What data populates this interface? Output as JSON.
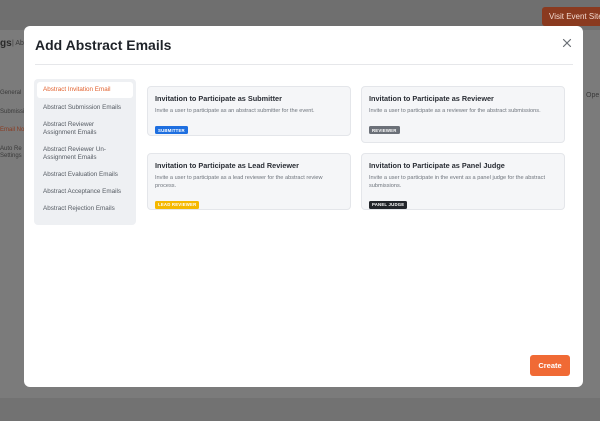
{
  "background": {
    "visit_button": "Visit Event Site",
    "page_title": "gs",
    "page_subtitle": "| Ab",
    "side_items": [
      "General",
      "Submissi",
      "Email No",
      "Auto Re",
      "Settings"
    ],
    "right_label": "Ope"
  },
  "modal": {
    "title": "Add Abstract Emails",
    "close_icon": "close-icon",
    "nav": [
      "Abstract Invitation Email",
      "Abstract Submission Emails",
      "Abstract Reviewer Assignment Emails",
      "Abstract Reviewer Un-Assignment Emails",
      "Abstract Evaluation Emails",
      "Abstract Acceptance Emails",
      "Abstract Rejection Emails"
    ],
    "cards": [
      {
        "title": "Invitation to Participate as Submitter",
        "description": "Invite a user to participate as an abstract submitter for the event.",
        "badge": "SUBMITTER",
        "badge_color": "#1e6fe0"
      },
      {
        "title": "Invitation to Participate as Reviewer",
        "description": "Invite a user to participate as a reviewer for the abstract submissions.",
        "badge": "REVIEWER",
        "badge_color": "#6b7078"
      },
      {
        "title": "Invitation to Participate as Lead Reviewer",
        "description": "Invite a user to participate as a lead reviewer for the abstract review process.",
        "badge": "LEAD REVIEWER",
        "badge_color": "#f5b800"
      },
      {
        "title": "Invitation to Participate as Panel Judge",
        "description": "Invite a user to participate in the event as a panel judge for the abstract submissions.",
        "badge": "PANEL JUDGE",
        "badge_color": "#22252a"
      }
    ],
    "create_label": "Create"
  },
  "colors": {
    "accent": "#f06a35",
    "active_nav_text": "#e2622f"
  }
}
